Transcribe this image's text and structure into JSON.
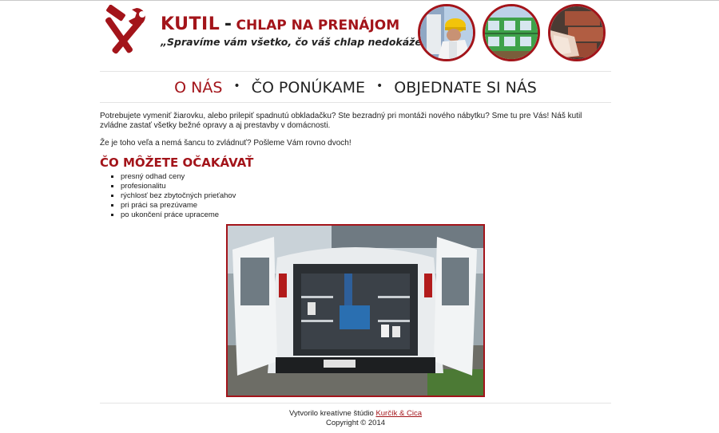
{
  "header": {
    "brand_main": "KUTIL",
    "brand_dash": "-",
    "brand_sub": "CHLAP NA PRENÁJOM",
    "slogan": "„Spravíme vám všetko, čo váš chlap nedokáže!\"",
    "photos": [
      "worker-with-hard-hat-photo",
      "green-house-renovation-photo",
      "brick-wall-photo"
    ]
  },
  "nav": {
    "items": [
      {
        "label": "O NÁS",
        "active": true
      },
      {
        "label": "ČO PONÚKAME",
        "active": false
      },
      {
        "label": "OBJEDNATE SI NÁS",
        "active": false
      }
    ],
    "separator": "•"
  },
  "content": {
    "paragraph1": "Potrebujete vymeniť žiarovku, alebo prilepiť spadnutú obkladačku? Ste bezradný pri montáži nového nábytku? Sme tu pre Vás! Náš kutil zvládne zastať všetky bežné opravy a aj prestavby v domácnosti.",
    "paragraph2": "Že je toho veľa a nemá šancu to zvládnuť? Pošleme Vám rovno dvoch!",
    "heading": "ČO MÔŽETE OČAKÁVAŤ",
    "list": [
      "presný odhad ceny",
      "profesionalitu",
      "rýchlosť bez zbytočných prieťahov",
      "pri práci sa prezúvame",
      "po ukončení práce upraceme"
    ],
    "image": "service-van-photo"
  },
  "footer": {
    "credit_prefix": "Vytvorilo kreatívne štúdio",
    "credit_link": "Kurčík & Cica",
    "copyright": "Copyright © 2014"
  },
  "colors": {
    "accent": "#a3141a",
    "text": "#222222",
    "divider": "#e4e4e4"
  }
}
